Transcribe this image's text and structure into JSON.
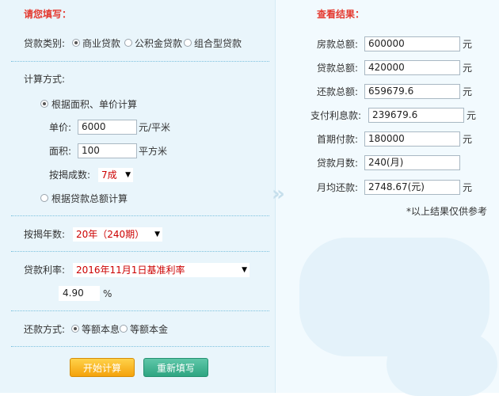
{
  "left": {
    "heading": "请您填写：",
    "loan_type": {
      "label": "贷款类别:",
      "options": [
        "商业贷款",
        "公积金贷款",
        "组合型贷款"
      ],
      "selected": 0
    },
    "calc_method": {
      "label": "计算方式:",
      "option_area_price": "根据面积、单价计算",
      "unit_price_label": "单价:",
      "unit_price_value": "6000",
      "unit_price_unit": "元/平米",
      "area_label": "面积:",
      "area_value": "100",
      "area_unit": "平方米",
      "ratio_label": "按揭成数:",
      "ratio_value": "7成",
      "option_total": "根据贷款总额计算"
    },
    "years": {
      "label": "按揭年数:",
      "value": "20年（240期）"
    },
    "rate": {
      "label": "贷款利率:",
      "value": "2016年11月1日基准利率",
      "rate_value": "4.90",
      "rate_unit": "%"
    },
    "repay": {
      "label": "还款方式:",
      "options": [
        "等额本息",
        "等额本金"
      ],
      "selected": 0
    },
    "buttons": {
      "calculate": "开始计算",
      "reset": "重新填写"
    }
  },
  "right": {
    "heading": "查看结果：",
    "fields": {
      "house_total": {
        "label": "房款总额:",
        "value": "600000",
        "unit": "元"
      },
      "loan_total": {
        "label": "贷款总额:",
        "value": "420000",
        "unit": "元"
      },
      "repay_total": {
        "label": "还款总额:",
        "value": "659679.6",
        "unit": "元"
      },
      "interest": {
        "label": "支付利息款:",
        "value": "239679.6",
        "unit": "元"
      },
      "down_payment": {
        "label": "首期付款:",
        "value": "180000",
        "unit": "元"
      },
      "months": {
        "label": "贷款月数:",
        "value": "240(月)"
      },
      "monthly": {
        "label": "月均还款:",
        "value": "2748.67(元)",
        "unit": "元"
      }
    },
    "note": "*以上结果仅供参考"
  },
  "colors": {
    "accent_red": "#e4392f",
    "panel_left": "#e9f5fb",
    "btn_orange": "#f4a20b",
    "btn_green": "#2ea581"
  }
}
